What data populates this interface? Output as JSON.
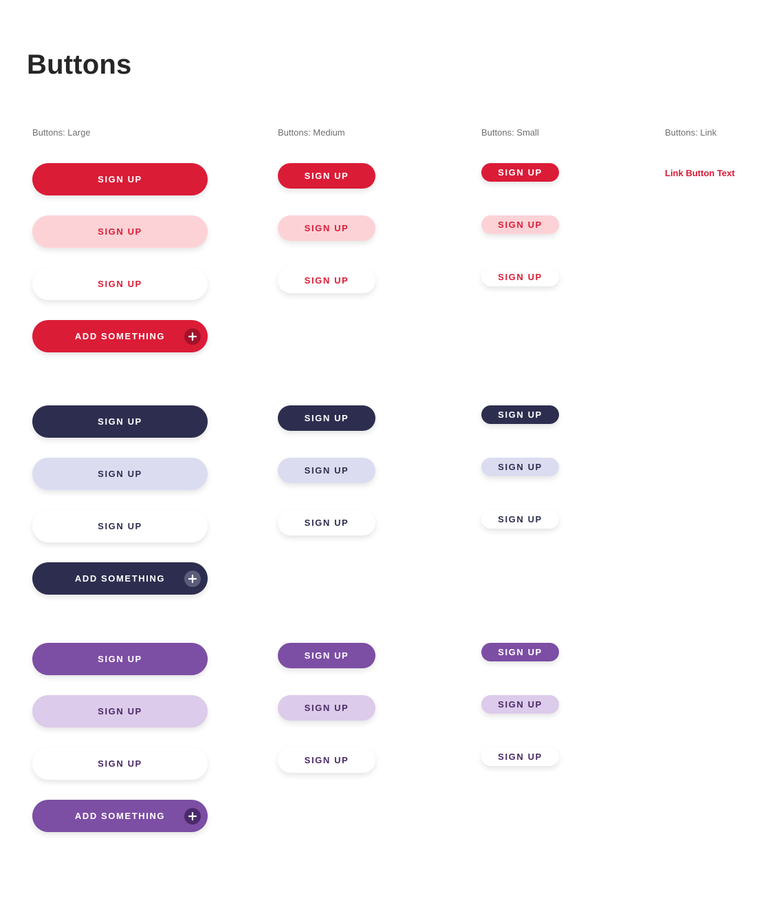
{
  "page": {
    "title": "Buttons"
  },
  "columns": {
    "large": "Buttons: Large",
    "medium": "Buttons: Medium",
    "small": "Buttons: Small",
    "link": "Buttons: Link"
  },
  "link_button": {
    "label": "Link Button Text",
    "color": "#d91c37"
  },
  "themes": [
    {
      "name": "red",
      "primary": "#db1c37",
      "light": "#fdd2d6",
      "light_text": "#db1c37",
      "outline_text": "#db1c37",
      "plus_bg": "#a4112a",
      "sign_up_label": "SIGN UP",
      "add_label": "ADD SOMETHING"
    },
    {
      "name": "navy",
      "primary": "#2d2e4f",
      "light": "#dcdcf1",
      "light_text": "#2d2e4f",
      "outline_text": "#2d2e4f",
      "plus_bg": "#5b5c79",
      "sign_up_label": "SIGN UP",
      "add_label": "ADD SOMETHING"
    },
    {
      "name": "purple",
      "primary": "#7c4ea4",
      "light": "#dccbea",
      "light_text": "#4a2a66",
      "outline_text": "#4a2a66",
      "plus_bg": "#4b2a6b",
      "sign_up_label": "SIGN UP",
      "add_label": "ADD SOMETHING"
    }
  ]
}
